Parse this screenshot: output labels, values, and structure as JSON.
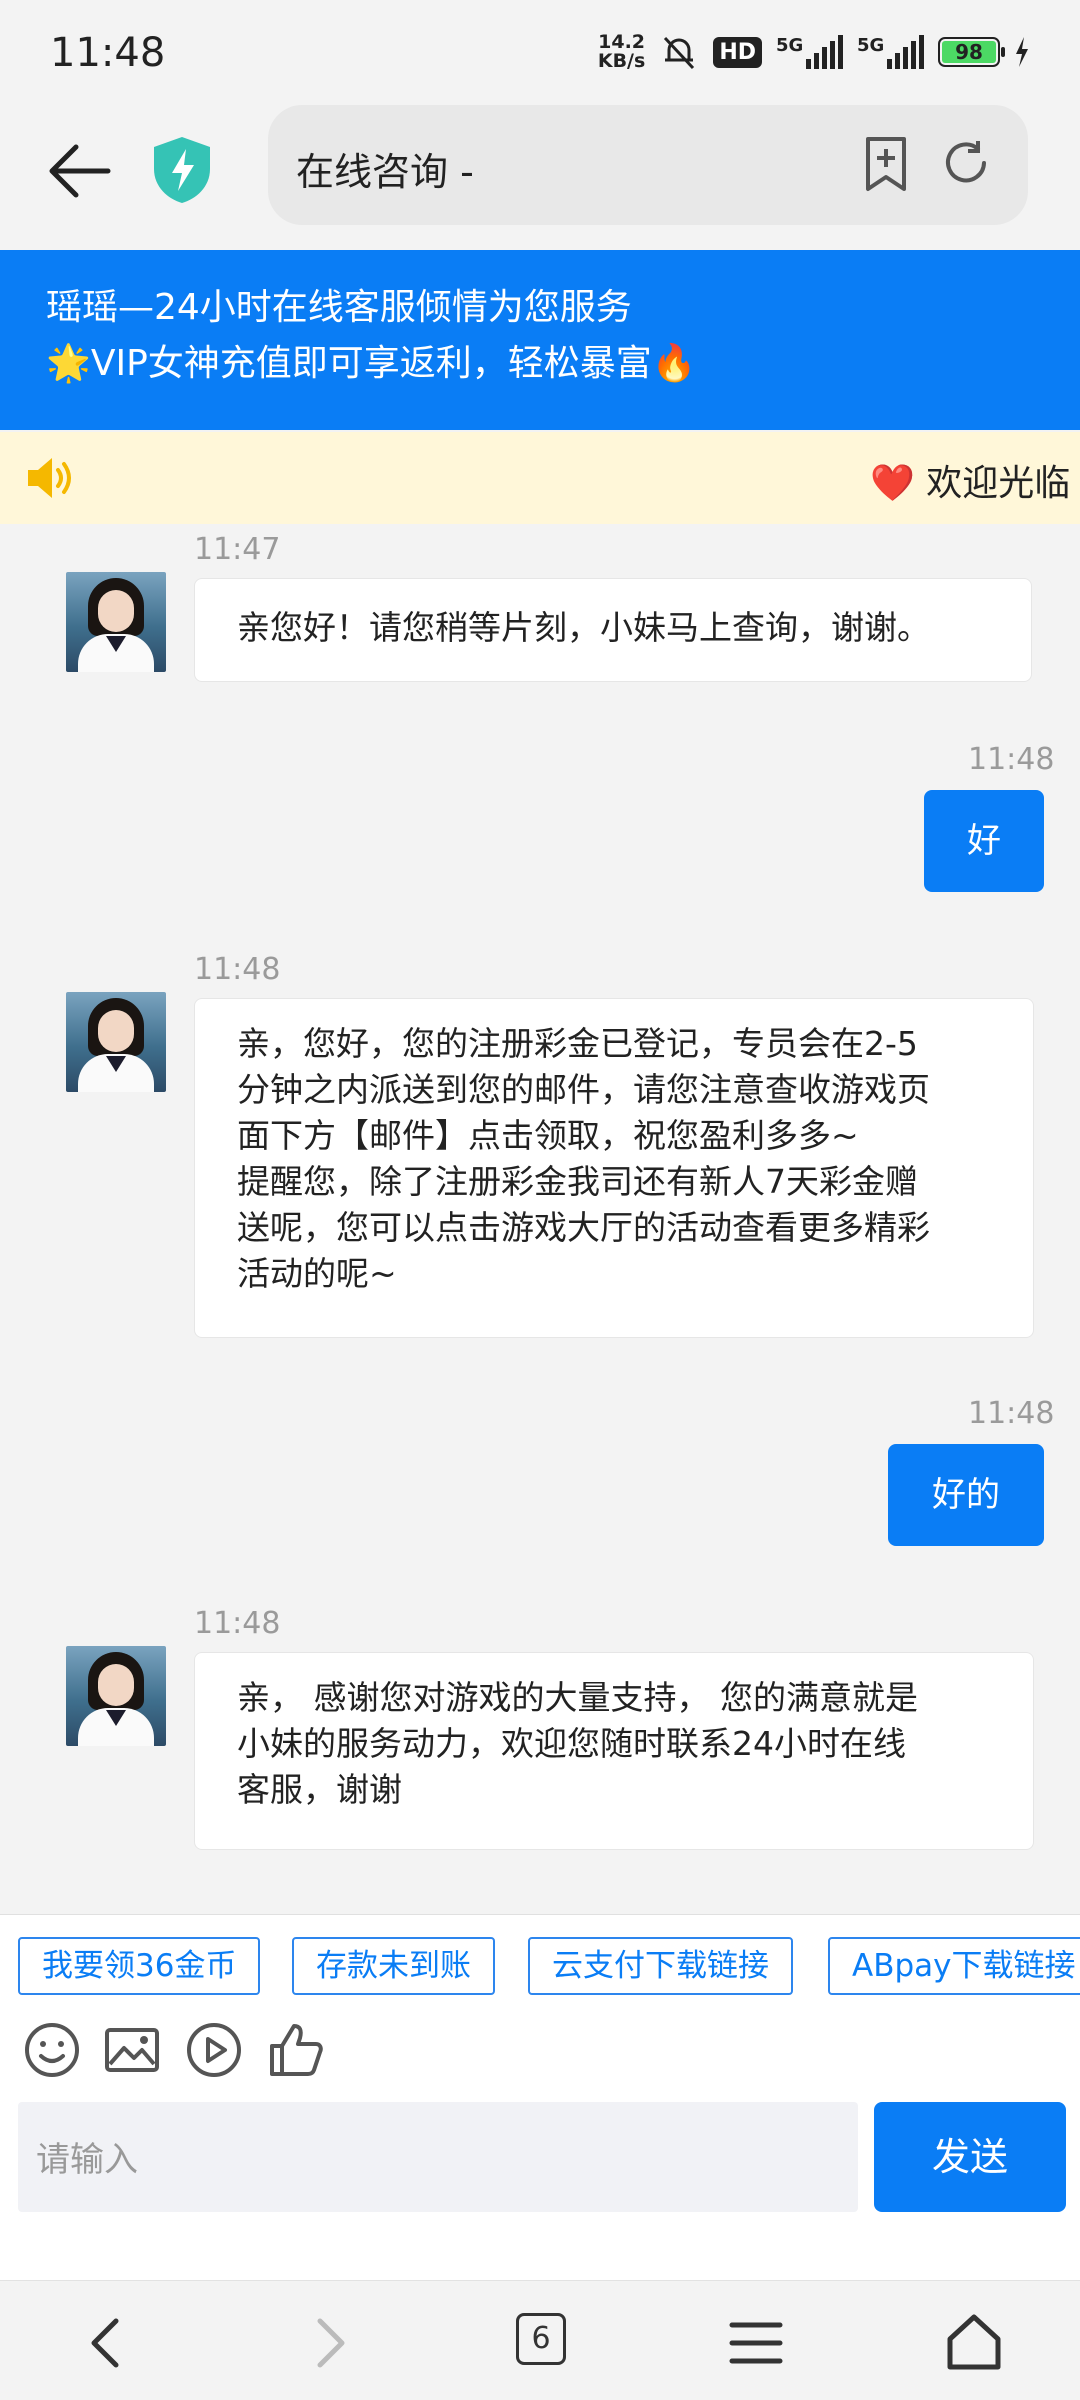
{
  "status_bar": {
    "time": "11:48",
    "net_speed_value": "14.2",
    "net_speed_unit": "KB/s",
    "hd_label": "HD",
    "network_1": "5G",
    "network_2": "5G",
    "battery_level": "98"
  },
  "address_bar": {
    "url_text": "在线咨询 -"
  },
  "banner": {
    "line1": "瑶瑶—24小时在线客服倾情为您服务",
    "line2": "🌟VIP女神充值即可享返利，轻松暴富🔥"
  },
  "notice": {
    "text": "❤️ 欢迎光临"
  },
  "messages": [
    {
      "from": "agent",
      "time": "11:47",
      "text": "亲您好！请您稍等片刻，小妹马上查询，谢谢。"
    },
    {
      "from": "user",
      "time": "11:48",
      "text": "好"
    },
    {
      "from": "agent",
      "time": "11:48",
      "lines": [
        "亲，您好，您的注册彩金已登记，专员会在2-5",
        "分钟之内派送到您的邮件，请您注意查收游戏页",
        "面下方【邮件】点击领取，祝您盈利多多~",
        "提醒您，除了注册彩金我司还有新人7天彩金赠",
        "送呢，您可以点击游戏大厅的活动查看更多精彩",
        "活动的呢~"
      ]
    },
    {
      "from": "user",
      "time": "11:48",
      "text": "好的"
    },
    {
      "from": "agent",
      "time": "11:48",
      "lines": [
        "亲， 感谢您对游戏的大量支持， 您的满意就是",
        "小妹的服务动力，欢迎您随时联系24小时在线",
        "客服，谢谢"
      ]
    }
  ],
  "quick_replies": [
    "我要领36金币",
    "存款未到账",
    "云支付下载链接",
    "ABpay下载链接"
  ],
  "input": {
    "placeholder": "请输入",
    "send_label": "发送"
  },
  "navbar": {
    "tab_count": "6"
  },
  "colors": {
    "accent": "#0a7df5",
    "notice_bg": "#fff7d9"
  }
}
